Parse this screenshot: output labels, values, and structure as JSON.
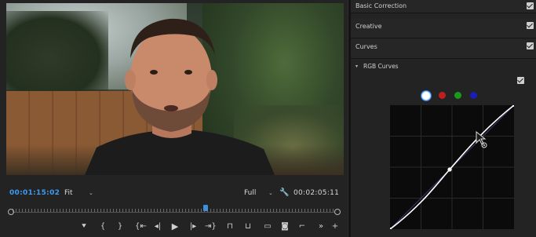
{
  "monitor": {
    "current_timecode": "00:01:15:02",
    "fit_label": "Fit",
    "full_label": "Full",
    "duration_timecode": "00:02:05:11",
    "playhead_progress": 0.6
  },
  "controls": [
    {
      "name": "add-marker-button",
      "glyph": "⯆"
    },
    {
      "name": "mark-in-button",
      "glyph": "{"
    },
    {
      "name": "mark-out-button",
      "glyph": "}"
    },
    {
      "name": "go-to-in-button",
      "glyph": "{⇤"
    },
    {
      "name": "step-back-button",
      "glyph": "◂|"
    },
    {
      "name": "play-button",
      "glyph": "▶"
    },
    {
      "name": "step-forward-button",
      "glyph": "|▸"
    },
    {
      "name": "go-to-out-button",
      "glyph": "⇥}"
    },
    {
      "name": "lift-button",
      "glyph": "⊓"
    },
    {
      "name": "extract-button",
      "glyph": "⊔"
    },
    {
      "name": "safe-margins-button",
      "glyph": "▭"
    },
    {
      "name": "export-frame-button",
      "glyph": "◙"
    },
    {
      "name": "comparison-view-button",
      "glyph": "⌐"
    },
    {
      "name": "button-editor-overflow",
      "glyph": "»"
    },
    {
      "name": "add-button",
      "glyph": "+"
    }
  ],
  "lumetri": {
    "sections": [
      {
        "label": "Basic Correction",
        "enabled": true
      },
      {
        "label": "Creative",
        "enabled": true
      },
      {
        "label": "Curves",
        "enabled": true
      }
    ],
    "rgb_curves_label": "RGB Curves",
    "rgb_curves_enabled": true,
    "channels": [
      "white",
      "red",
      "green",
      "blue"
    ],
    "colors": {
      "accent": "#3d9cf0",
      "panel": "#232323",
      "curve": "#ffffff"
    }
  }
}
